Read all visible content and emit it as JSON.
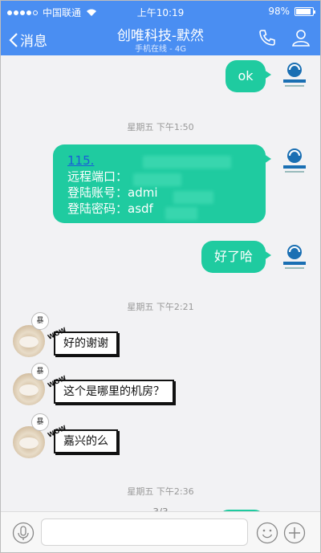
{
  "statusbar": {
    "carrier": "中国联通",
    "time": "上午10:19",
    "battery": "98%"
  },
  "navbar": {
    "back_label": "消息",
    "title": "创唯科技-默然",
    "subtitle": "手机在线 - 4G"
  },
  "messages": {
    "m1": "ok",
    "ts1": "星期五 下午1:50",
    "m2_line1": "115.",
    "m2_line2": "远程端口：",
    "m2_line3": "登陆账号：admi",
    "m2_line4": "登陆密码：asdf",
    "m3": "好了哈",
    "ts2": "星期五 下午2:21",
    "t1": "好的谢谢",
    "t2": "这个是哪里的机房？",
    "t3": "嘉兴的么",
    "ts3": "星期五 下午2:36"
  },
  "badge_text": "暴",
  "comic_tag": "WOW",
  "page_indicator": "3/3",
  "colors": {
    "bar": "#4a8ef2",
    "my_bubble": "#1fcba0"
  }
}
